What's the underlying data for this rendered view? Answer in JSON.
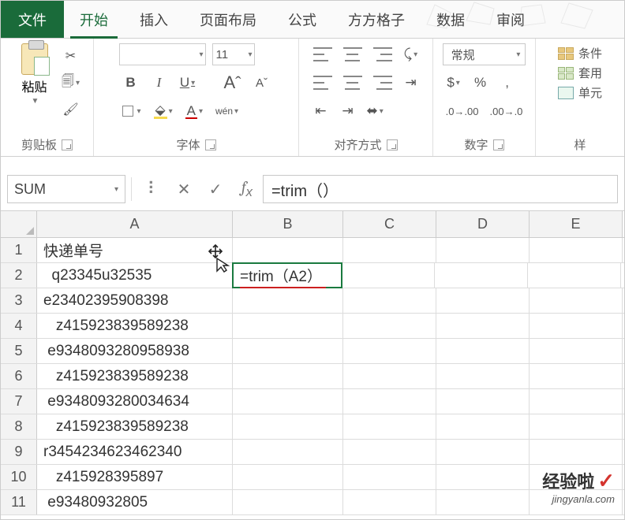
{
  "tabs": {
    "file": "文件",
    "home": "开始",
    "insert": "插入",
    "layout": "页面布局",
    "formulas": "公式",
    "fgz": "方方格子",
    "data": "数据",
    "review": "审阅"
  },
  "ribbon": {
    "clipboard": {
      "paste": "粘贴",
      "label": "剪贴板"
    },
    "font": {
      "bold": "B",
      "italic": "I",
      "underline": "U",
      "bigA": "A",
      "smallA": "A",
      "wen": "wén",
      "label": "字体"
    },
    "align": {
      "label": "对齐方式"
    },
    "number": {
      "format": "常规",
      "label": "数字"
    },
    "styles": {
      "cond": "条件",
      "table": "套用",
      "cell": "单元",
      "label": "样"
    }
  },
  "formula_bar": {
    "name": "SUM",
    "formula": "=trim（）"
  },
  "columns": [
    "A",
    "B",
    "C",
    "D",
    "E"
  ],
  "rows": [
    {
      "n": "1",
      "A": "快递单号",
      "B": ""
    },
    {
      "n": "2",
      "A": "  q23345u32535",
      "B": "=trim（A2）"
    },
    {
      "n": "3",
      "A": "e23402395908398",
      "B": ""
    },
    {
      "n": "4",
      "A": "   z415923839589238",
      "B": ""
    },
    {
      "n": "5",
      "A": " e9348093280958938",
      "B": ""
    },
    {
      "n": "6",
      "A": "   z415923839589238",
      "B": ""
    },
    {
      "n": "7",
      "A": " e9348093280034634",
      "B": ""
    },
    {
      "n": "8",
      "A": "   z415923839589238",
      "B": ""
    },
    {
      "n": "9",
      "A": "r3454234623462340",
      "B": ""
    },
    {
      "n": "10",
      "A": "   z415928395897",
      "B": ""
    },
    {
      "n": "11",
      "A": " e93480932805",
      "B": ""
    }
  ],
  "watermark": {
    "top": "经验啦",
    "bottom": "jingyanla.com"
  }
}
